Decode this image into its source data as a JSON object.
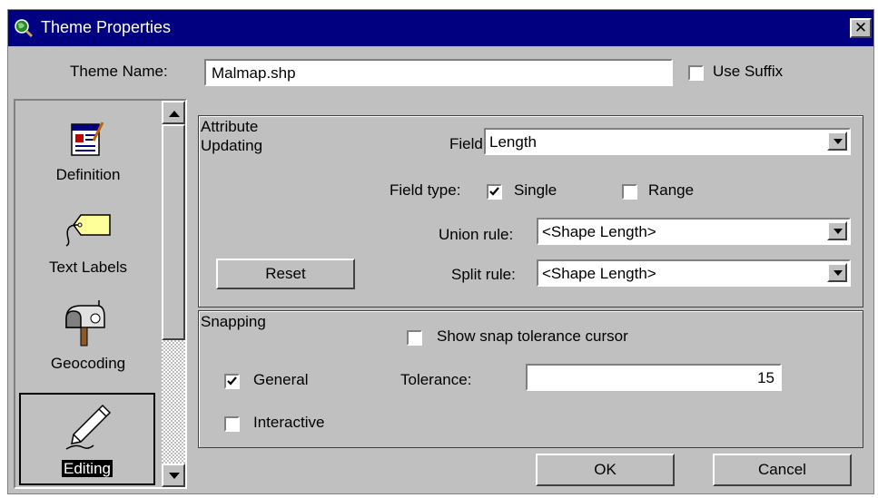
{
  "window": {
    "title": "Theme Properties",
    "close_glyph": "✕"
  },
  "theme_name": {
    "label": "Theme Name:",
    "value": "Malmap.shp",
    "use_suffix_label": "Use Suffix",
    "use_suffix_checked": false
  },
  "sidebar": {
    "items": [
      {
        "label": "Definition",
        "icon": "definition-icon",
        "selected": false
      },
      {
        "label": "Text Labels",
        "icon": "text-labels-icon",
        "selected": false
      },
      {
        "label": "Geocoding",
        "icon": "geocoding-icon",
        "selected": false
      },
      {
        "label": "Editing",
        "icon": "editing-icon",
        "selected": true
      }
    ]
  },
  "attribute_updating": {
    "group_label_line1": "Attribute",
    "group_label_line2": "Updating",
    "field_label": "Field:",
    "field_value": "Length",
    "field_type_label": "Field type:",
    "single_label": "Single",
    "single_checked": true,
    "range_label": "Range",
    "range_checked": false,
    "union_rule_label": "Union rule:",
    "union_rule_value": "<Shape Length>",
    "split_rule_label": "Split rule:",
    "split_rule_value": "<Shape Length>",
    "reset_label": "Reset"
  },
  "snapping": {
    "group_label": "Snapping",
    "show_cursor_label": "Show snap tolerance cursor",
    "show_cursor_checked": false,
    "general_label": "General",
    "general_checked": true,
    "interactive_label": "Interactive",
    "interactive_checked": false,
    "tolerance_label": "Tolerance:",
    "tolerance_value": "15"
  },
  "buttons": {
    "ok_label": "OK",
    "cancel_label": "Cancel"
  }
}
